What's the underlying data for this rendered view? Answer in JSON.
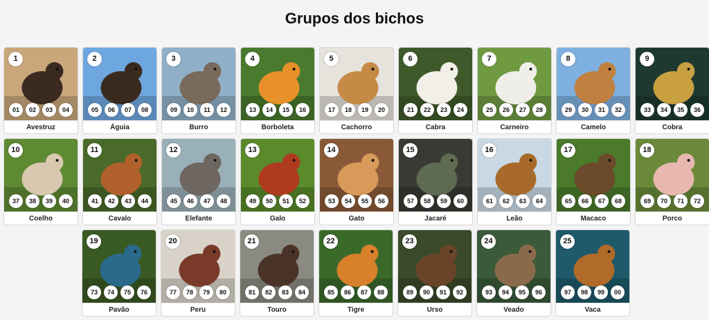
{
  "page": {
    "title": "Grupos dos bichos"
  },
  "animals": [
    {
      "group": "1",
      "name": "Avestruz",
      "numbers": [
        "01",
        "02",
        "03",
        "04"
      ],
      "bg": "#c9a77a",
      "fg": "#3a2a20",
      "icon": "ostrich-icon"
    },
    {
      "group": "2",
      "name": "Águia",
      "numbers": [
        "05",
        "06",
        "07",
        "08"
      ],
      "bg": "#6ea7e0",
      "fg": "#3a2a1e",
      "icon": "eagle-icon"
    },
    {
      "group": "3",
      "name": "Burro",
      "numbers": [
        "09",
        "10",
        "11",
        "12"
      ],
      "bg": "#8fb0c8",
      "fg": "#7a6a5c",
      "icon": "donkey-icon"
    },
    {
      "group": "4",
      "name": "Borboleta",
      "numbers": [
        "13",
        "14",
        "15",
        "16"
      ],
      "bg": "#4a7a2e",
      "fg": "#e8902a",
      "icon": "butterfly-icon"
    },
    {
      "group": "5",
      "name": "Cachorro",
      "numbers": [
        "17",
        "18",
        "19",
        "20"
      ],
      "bg": "#e6e2dc",
      "fg": "#c58a45",
      "icon": "dog-icon"
    },
    {
      "group": "6",
      "name": "Cabra",
      "numbers": [
        "21",
        "22",
        "23",
        "24"
      ],
      "bg": "#3f5a2a",
      "fg": "#f2efe8",
      "icon": "goat-icon"
    },
    {
      "group": "7",
      "name": "Carneiro",
      "numbers": [
        "25",
        "26",
        "27",
        "28"
      ],
      "bg": "#6f9a42",
      "fg": "#f0eee8",
      "icon": "sheep-icon"
    },
    {
      "group": "8",
      "name": "Camelo",
      "numbers": [
        "29",
        "30",
        "31",
        "32"
      ],
      "bg": "#7eb0e0",
      "fg": "#c08040",
      "icon": "camel-icon"
    },
    {
      "group": "9",
      "name": "Cobra",
      "numbers": [
        "33",
        "34",
        "35",
        "36"
      ],
      "bg": "#1e3a30",
      "fg": "#c8a040",
      "icon": "snake-icon"
    },
    {
      "group": "10",
      "name": "Coelho",
      "numbers": [
        "37",
        "38",
        "39",
        "40"
      ],
      "bg": "#5e8a34",
      "fg": "#d8c8b0",
      "icon": "rabbit-icon"
    },
    {
      "group": "11",
      "name": "Cavalo",
      "numbers": [
        "41",
        "42",
        "43",
        "44"
      ],
      "bg": "#4a6a2a",
      "fg": "#b0602a",
      "icon": "horse-icon"
    },
    {
      "group": "12",
      "name": "Elefante",
      "numbers": [
        "45",
        "46",
        "47",
        "48"
      ],
      "bg": "#9ab0b8",
      "fg": "#6e6660",
      "icon": "elephant-icon"
    },
    {
      "group": "13",
      "name": "Galo",
      "numbers": [
        "49",
        "50",
        "51",
        "52"
      ],
      "bg": "#5a8a2a",
      "fg": "#b03a20",
      "icon": "rooster-icon"
    },
    {
      "group": "14",
      "name": "Gato",
      "numbers": [
        "53",
        "54",
        "55",
        "56"
      ],
      "bg": "#8a5a38",
      "fg": "#d89a58",
      "icon": "cat-icon"
    },
    {
      "group": "15",
      "name": "Jacaré",
      "numbers": [
        "57",
        "58",
        "59",
        "60"
      ],
      "bg": "#3a3a34",
      "fg": "#5e6a52",
      "icon": "alligator-icon"
    },
    {
      "group": "16",
      "name": "Leão",
      "numbers": [
        "61",
        "62",
        "63",
        "64"
      ],
      "bg": "#c8d8e4",
      "fg": "#a86a2a",
      "icon": "lion-icon"
    },
    {
      "group": "17",
      "name": "Macaco",
      "numbers": [
        "65",
        "66",
        "67",
        "68"
      ],
      "bg": "#4a7a2a",
      "fg": "#6a4a2a",
      "icon": "monkey-icon"
    },
    {
      "group": "18",
      "name": "Porco",
      "numbers": [
        "69",
        "70",
        "71",
        "72"
      ],
      "bg": "#6a8a3a",
      "fg": "#e8b8b0",
      "icon": "pig-icon"
    },
    {
      "group": "19",
      "name": "Pavão",
      "numbers": [
        "73",
        "74",
        "75",
        "76"
      ],
      "bg": "#3a5a24",
      "fg": "#2a6a8a",
      "icon": "peacock-icon"
    },
    {
      "group": "20",
      "name": "Peru",
      "numbers": [
        "77",
        "78",
        "79",
        "80"
      ],
      "bg": "#d8d2c8",
      "fg": "#7a3a2a",
      "icon": "turkey-icon"
    },
    {
      "group": "21",
      "name": "Touro",
      "numbers": [
        "81",
        "82",
        "83",
        "84"
      ],
      "bg": "#8a8a80",
      "fg": "#4a3428",
      "icon": "bull-icon"
    },
    {
      "group": "22",
      "name": "Tigre",
      "numbers": [
        "85",
        "86",
        "87",
        "88"
      ],
      "bg": "#3a6a2a",
      "fg": "#d8802a",
      "icon": "tiger-icon"
    },
    {
      "group": "23",
      "name": "Urso",
      "numbers": [
        "89",
        "90",
        "91",
        "92"
      ],
      "bg": "#3a4a2a",
      "fg": "#6a4428",
      "icon": "bear-icon"
    },
    {
      "group": "24",
      "name": "Veado",
      "numbers": [
        "93",
        "94",
        "95",
        "96"
      ],
      "bg": "#3a5a3a",
      "fg": "#8a6a4a",
      "icon": "deer-icon"
    },
    {
      "group": "25",
      "name": "Vaca",
      "numbers": [
        "97",
        "98",
        "99",
        "00"
      ],
      "bg": "#1e5a6a",
      "fg": "#b06a2a",
      "icon": "cow-icon"
    }
  ]
}
